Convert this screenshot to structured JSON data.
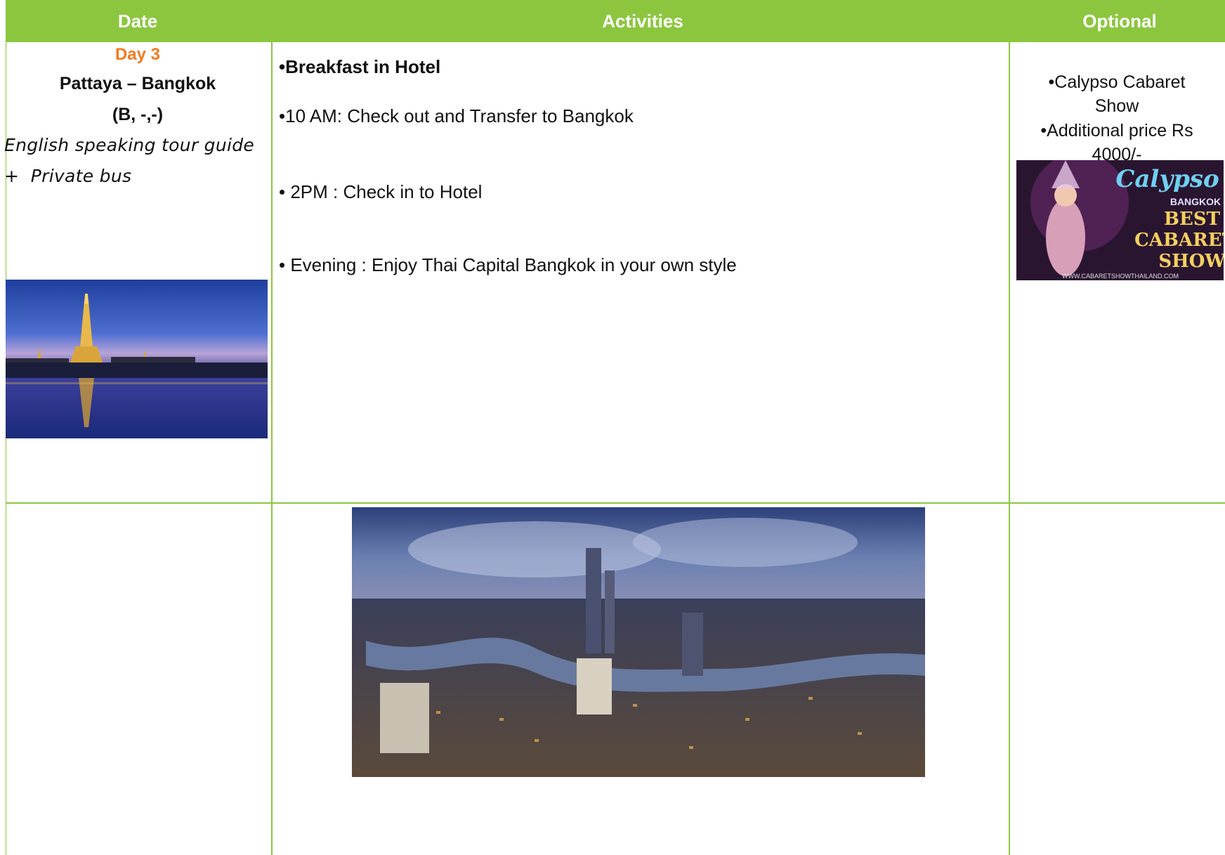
{
  "header": {
    "date_label": "Date",
    "activities_label": "Activities",
    "optional_label": "Optional"
  },
  "date_cell": {
    "day": "Day 3",
    "route": "Pattaya – Bangkok",
    "meals": "(B, -,-)",
    "guide": "English speaking tour guide",
    "transport": "+  Private bus",
    "image": "wat-arun-temple-photo"
  },
  "activities": [
    {
      "text": "•Breakfast in Hotel",
      "bold": true
    },
    {
      "text": "•10 AM: Check out and Transfer to Bangkok",
      "bold": false
    },
    {
      "text": "• 2PM : Check in to Hotel",
      "bold": false
    },
    {
      "text": "• Evening : Enjoy Thai Capital Bangkok in your own style",
      "bold": false
    }
  ],
  "optional": {
    "item1": "•Calypso Cabaret",
    "item1_cont": "Show",
    "item2": "•Additional price Rs",
    "item2_cont": "4000/-",
    "image": "calypso-cabaret-poster",
    "poster_logo": "Calypso",
    "poster_sub": "BANGKOK",
    "poster_line1": "BEST",
    "poster_line2": "CABARET",
    "poster_line3": "SHOW",
    "poster_url": "WWW.CABARETSHOWTHAILAND.COM"
  },
  "second_row": {
    "image": "bangkok-skyline-photo"
  },
  "colors": {
    "header_green": "#8cc63f",
    "day_orange": "#f47a20"
  }
}
